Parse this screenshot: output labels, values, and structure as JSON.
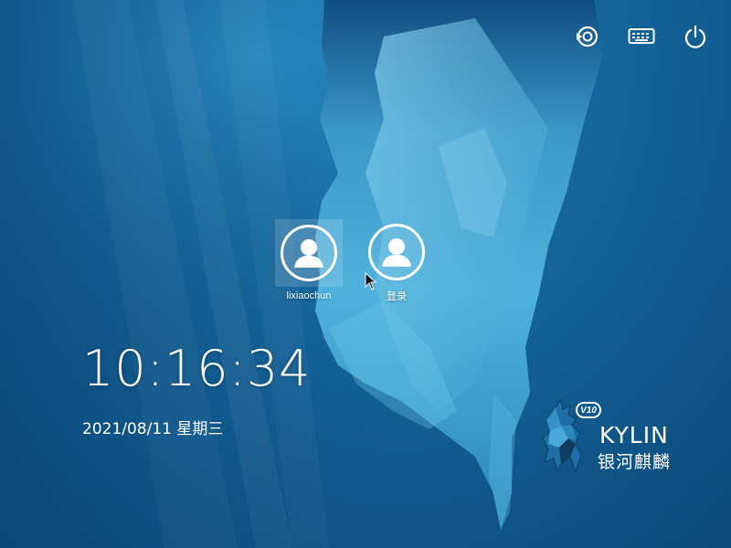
{
  "topbar": {
    "switch_icon": "switch-session-icon",
    "keyboard_icon": "keyboard-icon",
    "power_icon": "power-icon"
  },
  "users": [
    {
      "name": "lixiaochun",
      "selected": true
    },
    {
      "name": "登录",
      "selected": false
    }
  ],
  "clock": {
    "time": "10:16:34",
    "date": "2021/08/11 星期三"
  },
  "brand": {
    "version": "V10",
    "name": "KYLIN",
    "name_cn": "银河麒麟"
  },
  "colors": {
    "background": "#15679e",
    "text": "#ffffff"
  }
}
